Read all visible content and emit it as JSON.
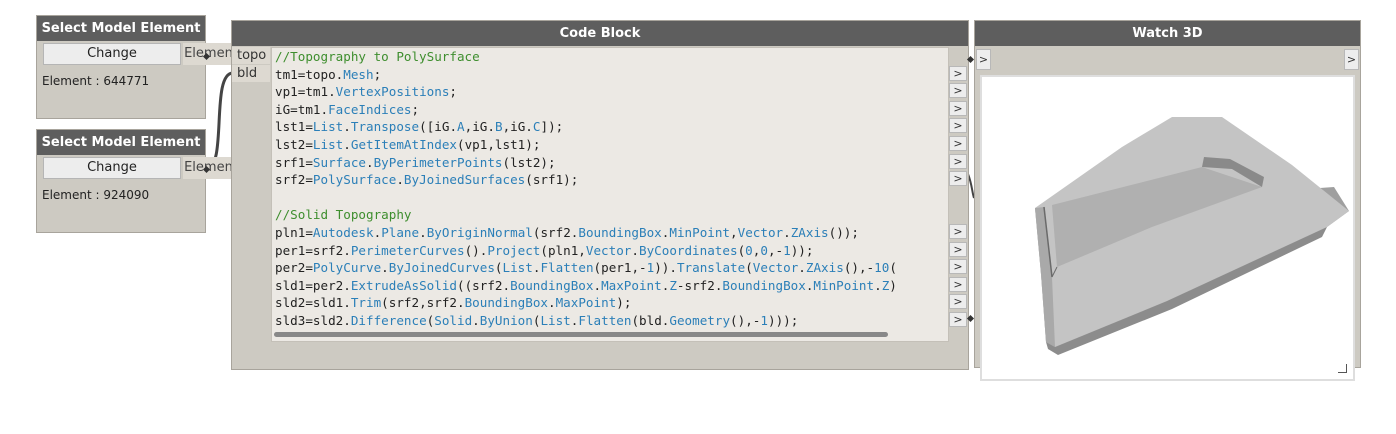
{
  "select_nodes": [
    {
      "title": "Select Model Element",
      "button": "Change",
      "output": "Element",
      "element_text": "Element : 644771"
    },
    {
      "title": "Select Model Element",
      "button": "Change",
      "output": "Element",
      "element_text": "Element : 924090"
    }
  ],
  "code_block": {
    "title": "Code Block",
    "inputs": [
      "topo",
      "bld"
    ],
    "lines": [
      "//Topography to PolySurface",
      "tm1=topo.Mesh;",
      "vp1=tm1.VertexPositions;",
      "iG=tm1.FaceIndices;",
      "lst1=List.Transpose([iG.A,iG.B,iG.C]);",
      "lst2=List.GetItemAtIndex(vp1,lst1);",
      "srf1=Surface.ByPerimeterPoints(lst2);",
      "srf2=PolySurface.ByJoinedSurfaces(srf1);",
      "",
      "//Solid Topography",
      "pln1=Autodesk.Plane.ByOriginNormal(srf2.BoundingBox.MinPoint,Vector.ZAxis());",
      "per1=srf2.PerimeterCurves().Project(pln1,Vector.ByCoordinates(0,0,-1));",
      "per2=PolyCurve.ByJoinedCurves(List.Flatten(per1,-1)).Translate(Vector.ZAxis(),-10(",
      "sld1=per2.ExtrudeAsSolid((srf2.BoundingBox.MaxPoint.Z-srf2.BoundingBox.MinPoint.Z)",
      "sld2=sld1.Trim(srf2,srf2.BoundingBox.MaxPoint);",
      "sld3=sld2.Difference(Solid.ByUnion(List.Flatten(bld.Geometry(),-1)));"
    ],
    "output_glyph": ">"
  },
  "watch3d": {
    "title": "Watch 3D",
    "in_glyph": ">",
    "out_glyph": ">"
  },
  "colors": {
    "header": "#5e5e5e",
    "node_body": "#cdcac2",
    "code_bg": "#ece9e4",
    "comment": "#3e8e2e",
    "identifier": "#2b7fb8",
    "number": "#2b7fb8",
    "wire": "#444444",
    "mesh": "#bdbdbd"
  },
  "icons": [
    "output-port-icon",
    "input-port-icon",
    "resize-grip-icon",
    "terrain-mesh-preview"
  ]
}
